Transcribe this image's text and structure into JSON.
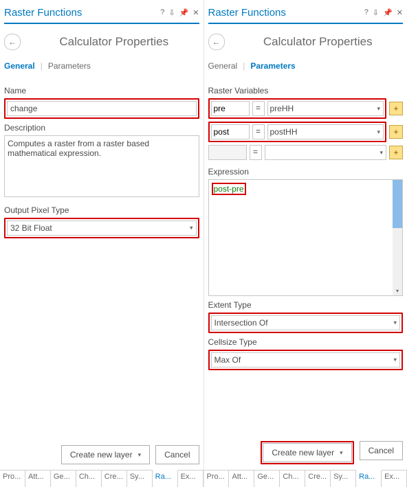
{
  "left": {
    "title": "Raster Functions",
    "subtitle": "Calculator Properties",
    "tabs": {
      "general": "General",
      "parameters": "Parameters"
    },
    "active_tab": "General",
    "name_label": "Name",
    "name_value": "change",
    "desc_label": "Description",
    "desc_value": "Computes a raster from a raster based mathematical expression.",
    "pixel_label": "Output Pixel Type",
    "pixel_value": "32 Bit Float",
    "create_label": "Create new layer",
    "cancel_label": "Cancel",
    "bottom_tabs": [
      "Pro...",
      "Att...",
      "Ge...",
      "Ch...",
      "Cre...",
      "Sy...",
      "Ra...",
      "Ex..."
    ],
    "bottom_active_index": 6
  },
  "right": {
    "title": "Raster Functions",
    "subtitle": "Calculator Properties",
    "tabs": {
      "general": "General",
      "parameters": "Parameters"
    },
    "active_tab": "Parameters",
    "vars_label": "Raster Variables",
    "vars": [
      {
        "name": "pre",
        "value": "preHH"
      },
      {
        "name": "post",
        "value": "postHH"
      },
      {
        "name": "",
        "value": ""
      }
    ],
    "expr_label": "Expression",
    "expr_value": "post-pre",
    "extent_label": "Extent Type",
    "extent_value": "Intersection Of",
    "cellsize_label": "Cellsize Type",
    "cellsize_value": "Max Of",
    "create_label": "Create new layer",
    "cancel_label": "Cancel",
    "bottom_tabs": [
      "Pro...",
      "Att...",
      "Ge...",
      "Ch...",
      "Cre...",
      "Sy...",
      "Ra...",
      "Ex..."
    ],
    "bottom_active_index": 6
  }
}
